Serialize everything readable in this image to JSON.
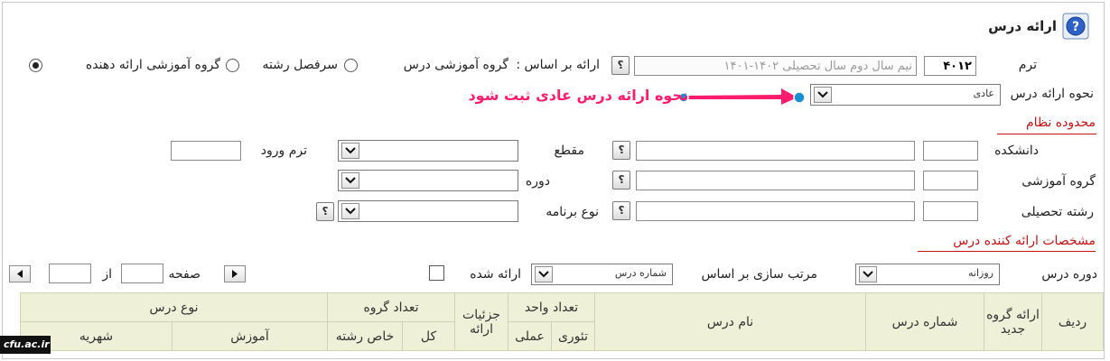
{
  "title": "ارائه درس",
  "icons": {
    "help": "help-circle-icon"
  },
  "term": {
    "label": "ترم",
    "value": "۴۰۱۲",
    "desc": "نیم سال دوم سال تحصیلی ۱۴۰۲-۱۴۰۱"
  },
  "offer_basis": {
    "label": "ارائه بر اساس :",
    "options": [
      {
        "label": "گروه آموزشی درس",
        "checked": false
      },
      {
        "label": "سرفصل رشته",
        "checked": false
      },
      {
        "label": "گروه آموزشی ارائه دهنده",
        "checked": true
      }
    ]
  },
  "offer_method": {
    "label": "نحوه ارائه درس",
    "value": "عادی"
  },
  "annotation": {
    "text": "نحوه ارائه درس عادی ثبت شود",
    "color": "#ff1b6e"
  },
  "system_scope": {
    "heading": "محدوده نظام",
    "faculty_label": "دانشکده",
    "group_label": "گروه آموزشی",
    "major_label": "رشته تحصیلی",
    "level_label": "مقطع",
    "period_label": "دوره",
    "program_label": "نوع برنامه",
    "entry_term_label": "ترم ورود"
  },
  "provider": {
    "heading": "مشخصات ارائه کننده درس"
  },
  "filters": {
    "course_period_label": "دوره درس",
    "course_period_value": "روزانه",
    "sort_label": "مرتب سازی بر اساس",
    "sort_value": "شماره درس",
    "offered_label": "ارائه شده",
    "page_label": "صفحه",
    "of_label": "از"
  },
  "table": {
    "row": "ردیف",
    "new_group": "ارائه گروه جدید",
    "course_number": "شماره درس",
    "course_name": "نام درس",
    "units": "تعداد واحد",
    "theory": "تئوری",
    "practical": "عملی",
    "offer_details": "جزئیات ارائه",
    "group_count": "تعداد گروه",
    "total": "کل",
    "major_specific": "خاص رشته",
    "course_type": "نوع درس",
    "education": "آموزش",
    "tuition": "شهریه"
  },
  "watermark": "cfu.ac.ir",
  "colors": {
    "table_header_bg": "#eef0d8",
    "accent_red": "#cc1111",
    "annotation_pink": "#ff1b6e"
  }
}
